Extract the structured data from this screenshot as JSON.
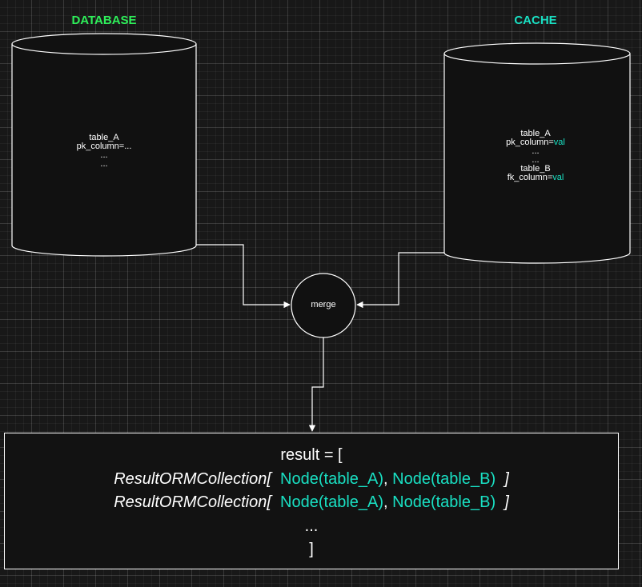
{
  "headings": {
    "database": "DATABASE",
    "cache": "CACHE"
  },
  "colors": {
    "database_heading": "#2ef05a",
    "cache_heading": "#19e0c3",
    "value_accent": "#19e0c3",
    "stroke": "#ffffff"
  },
  "database": {
    "lines": [
      "table_A",
      "pk_column=...",
      "...",
      "..."
    ]
  },
  "cache": {
    "table_a": "table_A",
    "pk_key": "pk_column=",
    "pk_value": "val",
    "dots1": "...",
    "dots2": "...",
    "table_b": "table_B",
    "fk_key": "fk_column=",
    "fk_value": "val"
  },
  "merge": {
    "label": "merge"
  },
  "result": {
    "line1": "result = [",
    "row_prefix": "ResultORMCollection[  ",
    "node_a": "Node(table_A)",
    "comma": ", ",
    "node_b": "Node(table_B)",
    "row_suffix": "  ]",
    "dots": "...",
    "closing": "]"
  }
}
